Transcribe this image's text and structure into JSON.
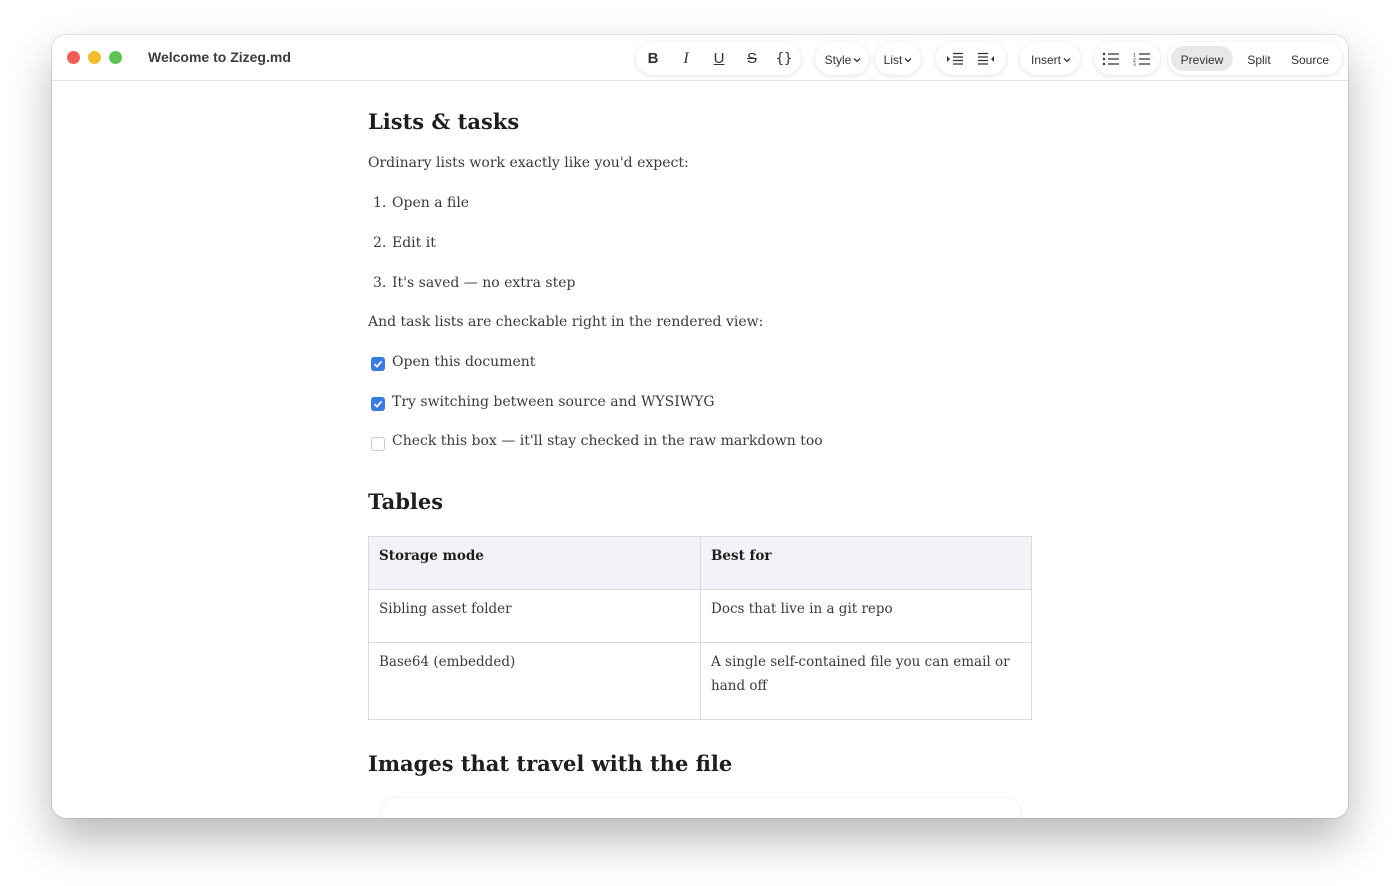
{
  "window": {
    "title": "Welcome to Zizeg.md"
  },
  "toolbar": {
    "bold": "B",
    "italic": "I",
    "underline": "U",
    "strike": "S",
    "code": "{}",
    "style_label": "Style",
    "list_label": "List",
    "insert_label": "Insert",
    "modes": [
      "Preview",
      "Split",
      "Source"
    ],
    "active_mode": "Preview"
  },
  "doc": {
    "lists_heading": "Lists & tasks",
    "lists_intro": "Ordinary lists work exactly like you'd expect:",
    "ordered": [
      {
        "num": "1.",
        "text": "Open a file"
      },
      {
        "num": "2.",
        "text": "Edit it"
      },
      {
        "num": "3.",
        "text": "It's saved — no extra step"
      }
    ],
    "tasks_intro": "And task lists are checkable right in the rendered view:",
    "tasks": [
      {
        "text": "Open this document",
        "checked": true
      },
      {
        "text": "Try switching between source and WYSIWYG",
        "checked": true
      },
      {
        "text": "Check this box — it'll stay checked in the raw markdown too",
        "checked": false
      }
    ],
    "tables_heading": "Tables",
    "table": {
      "headers": [
        "Storage mode",
        "Best for"
      ],
      "rows": [
        [
          "Sibling asset folder",
          "Docs that live in a git repo"
        ],
        [
          "Base64 (embedded)",
          "A single self-contained file you can email or hand off"
        ]
      ]
    },
    "images_heading": "Images that travel with the file"
  },
  "colors": {
    "checkbox_checked": "#3a7be0",
    "close": "#ee5d57",
    "minimize": "#f5bd2f",
    "maximize": "#5fc454",
    "active_segment": "#e8e8ea"
  }
}
